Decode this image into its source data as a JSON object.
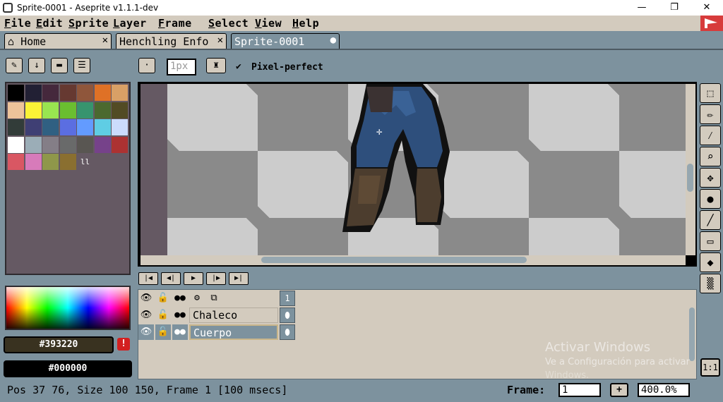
{
  "window": {
    "title": "Sprite-0001 - Aseprite v1.1.1-dev",
    "minimize": "—",
    "maximize": "❐",
    "close": "✕"
  },
  "menu": [
    "File",
    "Edit",
    "Sprite",
    "Layer",
    "Frame",
    "Select",
    "View",
    "Help"
  ],
  "tabs": [
    {
      "label": "Home",
      "close": "✕"
    },
    {
      "label": "Henchling Enfo",
      "close": "✕"
    },
    {
      "label": "Sprite-0001",
      "close": "●"
    }
  ],
  "context_bar": {
    "brush_size_placeholder": "1px",
    "pixel_perfect_check": "✔",
    "pixel_perfect_label": "Pixel-perfect"
  },
  "palette": {
    "colors": [
      "#000000",
      "#222034",
      "#45283c",
      "#663931",
      "#8f563b",
      "#df7126",
      "#d9a066",
      "#eec39a",
      "#fbf236",
      "#99e550",
      "#6abe30",
      "#37946e",
      "#4b692f",
      "#524b24",
      "#323c39",
      "#3f3f74",
      "#306082",
      "#5b6ee1",
      "#639bff",
      "#5fcde4",
      "#cbdbfc",
      "#ffffff",
      "#9badb7",
      "#847e87",
      "#696a6a",
      "#595652",
      "#76428a",
      "#ac3232",
      "#d95763",
      "#d77bba",
      "#8f974a",
      "#8a6f30"
    ],
    "marker": "ll"
  },
  "colors": {
    "foreground": "#393220",
    "background": "#000000",
    "warning": "!"
  },
  "layers": [
    {
      "name": "Chaleco"
    },
    {
      "name": "Cuerpo"
    }
  ],
  "timeline": {
    "frame_header": "1"
  },
  "watermark": {
    "line1": "Activar Windows",
    "line2": "Ve a Configuración para activar",
    "line3": "Windows."
  },
  "status": {
    "text": "Pos 37 76, Size 100 150, Frame 1 [100 msecs]",
    "frame_label": "Frame:",
    "frame_value": "1",
    "add_frame": "+",
    "zoom": "400.0%",
    "one_to_one": "1:1"
  }
}
